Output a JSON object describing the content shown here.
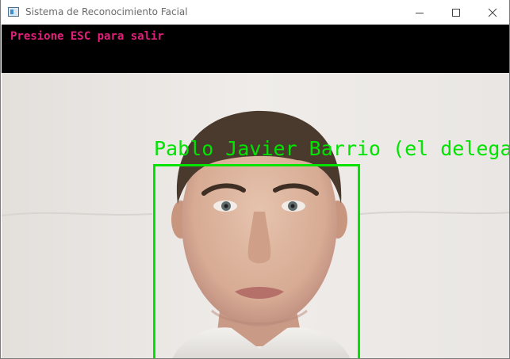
{
  "window": {
    "title": "Sistema de Reconocimiento Facial",
    "controls": [
      "minimize-icon",
      "maximize-icon",
      "close-icon"
    ]
  },
  "overlay": {
    "instruction": "Presione ESC para salir",
    "instruction_color": "#e2207a"
  },
  "detection": {
    "label": "Pablo Javier Barrio (el delegado)",
    "box_color": "#00e400"
  }
}
